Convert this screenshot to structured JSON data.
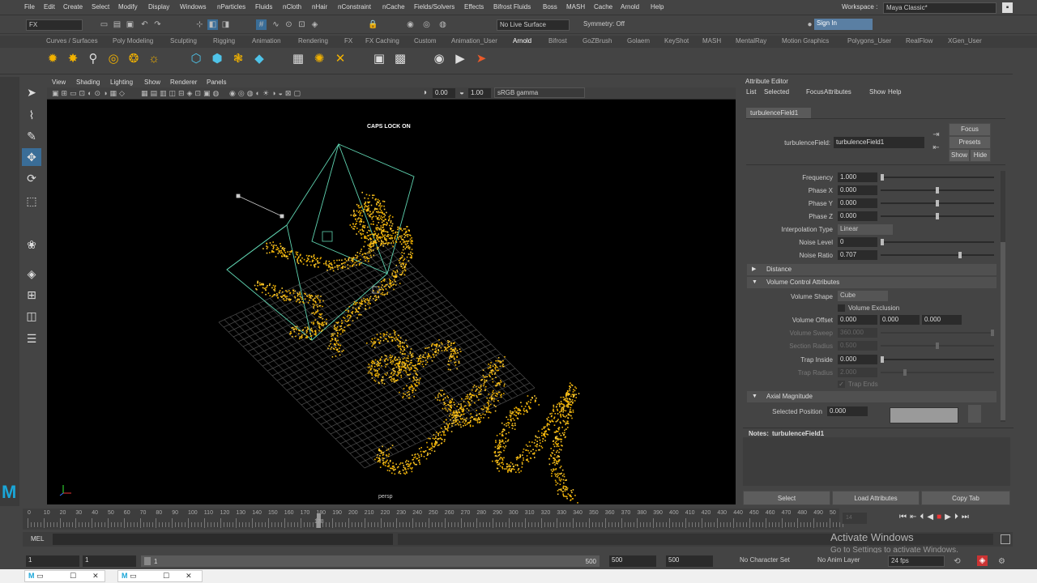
{
  "menubar": {
    "items": [
      "File",
      "Edit",
      "Create",
      "Select",
      "Modify",
      "Display",
      "Windows",
      "nParticles",
      "Fluids",
      "nCloth",
      "nHair",
      "nConstraint",
      "nCache",
      "Fields/Solvers",
      "Effects",
      "Bifrost Fluids",
      "Boss",
      "MASH",
      "Cache",
      "Arnold",
      "Help"
    ],
    "workspace_label": "Workspace :",
    "workspace_value": "Maya Classic*"
  },
  "status": {
    "menuset": "FX",
    "live_surface": "No Live Surface",
    "symmetry": "Symmetry: Off",
    "sign_in": "Sign In"
  },
  "shelf_tabs": [
    "Curves / Surfaces",
    "Poly Modeling",
    "Sculpting",
    "Rigging",
    "Animation",
    "Rendering",
    "FX",
    "FX Caching",
    "Custom",
    "Animation_User",
    "Arnold",
    "Bifrost",
    "GoZBrush",
    "Golaem",
    "KeyShot",
    "MASH",
    "MentalRay",
    "Motion Graphics",
    "Polygons_User",
    "RealFlow",
    "XGen_User"
  ],
  "shelf_active": "Arnold",
  "viewport": {
    "menu": [
      "View",
      "Shading",
      "Lighting",
      "Show",
      "Renderer",
      "Panels"
    ],
    "exposure": "0.00",
    "gamma": "1.00",
    "colorspace": "sRGB gamma",
    "caps": "CAPS LOCK ON",
    "camera": "persp"
  },
  "attr": {
    "title": "Attribute Editor",
    "menu": [
      "List",
      "Selected",
      "Focus",
      "Attributes",
      "Show",
      "Help"
    ],
    "tab": "turbulenceField1",
    "node_label": "turbulenceField:",
    "node_value": "turbulenceField1",
    "focus": "Focus",
    "presets": "Presets",
    "show": "Show",
    "hide": "Hide",
    "frequency_label": "Frequency",
    "frequency": "1.000",
    "phasex_label": "Phase X",
    "phasex": "0.000",
    "phasey_label": "Phase Y",
    "phasey": "0.000",
    "phasez_label": "Phase Z",
    "phasez": "0.000",
    "interp_label": "Interpolation Type",
    "interp": "Linear",
    "noiselevel_label": "Noise Level",
    "noiselevel": "0",
    "noiseratio_label": "Noise Ratio",
    "noiseratio": "0.707",
    "distance": "Distance",
    "volume_section": "Volume Control Attributes",
    "volshape_label": "Volume Shape",
    "volshape": "Cube",
    "volexcl": "Volume Exclusion",
    "voloffset_label": "Volume Offset",
    "voloffset": [
      "0.000",
      "0.000",
      "0.000"
    ],
    "volsweep_label": "Volume Sweep",
    "volsweep": "360.000",
    "secrad_label": "Section Radius",
    "secrad": "0.500",
    "trapin_label": "Trap Inside",
    "trapin": "0.000",
    "traprad_label": "Trap Radius",
    "traprad": "2.000",
    "trapends": "Trap Ends",
    "axial": "Axial Magnitude",
    "selpos_label": "Selected Position",
    "selpos": "0.000",
    "notes_label": "Notes:",
    "notes_value": "turbulenceField1",
    "select_btn": "Select",
    "load_btn": "Load Attributes",
    "copy_btn": "Copy Tab"
  },
  "timeline": {
    "ticks": [
      "0",
      "10",
      "20",
      "30",
      "40",
      "50",
      "60",
      "70",
      "80",
      "90",
      "100",
      "110",
      "120",
      "130",
      "140",
      "150",
      "160",
      "170",
      "180",
      "190",
      "200",
      "210",
      "220",
      "230",
      "240",
      "250",
      "260",
      "270",
      "280",
      "290",
      "300",
      "310",
      "320",
      "330",
      "340",
      "350",
      "360",
      "370",
      "380",
      "390",
      "400",
      "410",
      "420",
      "430",
      "440",
      "450",
      "460",
      "470",
      "480",
      "490",
      "50"
    ],
    "current": "178",
    "current_frame": "14"
  },
  "cmd": {
    "label": "MEL",
    "activate1": "Activate Windows",
    "activate2": "Go to Settings to activate Windows."
  },
  "range": {
    "start": "1",
    "start2": "1",
    "slider_left": "1",
    "slider_right": "500",
    "end": "500",
    "end2": "500",
    "charset": "No Character Set",
    "animlayer": "No Anim Layer",
    "fps": "24 fps"
  }
}
